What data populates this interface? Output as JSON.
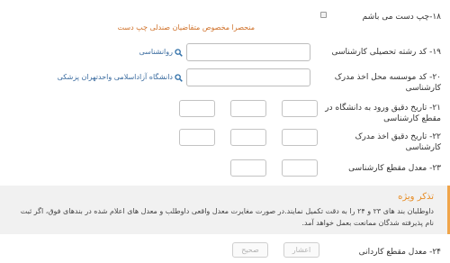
{
  "q18": {
    "label": "۱۸-چپ دست می باشم",
    "checked": false,
    "hint": "منحصرا مخصوص متقاضیان صندلی چپ دست"
  },
  "q19": {
    "label": "۱۹- کد رشته تحصیلی کارشناسی",
    "value": "",
    "lookup_text": "روانشناسی",
    "lookup_icon": "search-icon"
  },
  "q20": {
    "label_line1": "۲۰- کد موسسه محل اخذ مدرک",
    "label_line2": "کارشناسی",
    "value": "",
    "lookup_text": "دانشگاه آزاداسلامی واحدتهران پزشکی",
    "lookup_icon": "search-icon"
  },
  "q21": {
    "label_line1": "۲۱- تاریخ دقیق ورود به دانشگاه در",
    "label_line2": "مقطع کارشناسی",
    "day": "",
    "month": "",
    "year": ""
  },
  "q22": {
    "label_line1": "۲۲- تاریخ دقیق اخذ مدرک",
    "label_line2": "کارشناسی",
    "day": "",
    "month": "",
    "year": ""
  },
  "q23": {
    "label": "۲۳- معدل مقطع کارشناسی",
    "integer": "",
    "decimal": ""
  },
  "notice": {
    "title": "تذکر ویژه",
    "text": "داوطلبان بند های ۲۳ و ۲۴ را به دقت تکمیل نمایند.در صورت مغایرت معدل واقعی داوطلب و معدل های اعلام شده در بندهای فوق، اگر ثبت نام پذیرفته شدگان ممانعت بعمل خواهد آمد."
  },
  "q24": {
    "label": "۲۴- معدل مقطع کاردانی",
    "decimal_button": "اعشار",
    "integer_button": "صحیح"
  },
  "colors": {
    "accent_orange": "#e78d26",
    "link_blue": "#2f6fa8",
    "notice_bg": "#f1f1f1"
  }
}
